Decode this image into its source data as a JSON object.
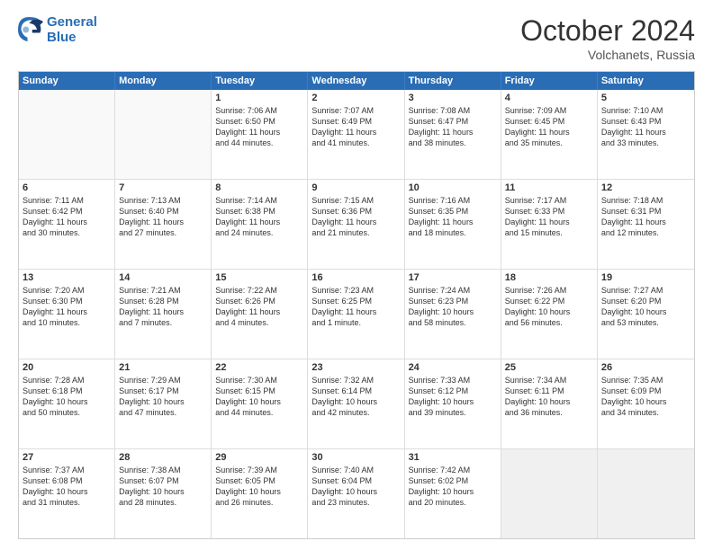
{
  "logo": {
    "line1": "General",
    "line2": "Blue"
  },
  "title": "October 2024",
  "location": "Volchanets, Russia",
  "days_of_week": [
    "Sunday",
    "Monday",
    "Tuesday",
    "Wednesday",
    "Thursday",
    "Friday",
    "Saturday"
  ],
  "weeks": [
    [
      {
        "day": "",
        "empty": true,
        "lines": []
      },
      {
        "day": "",
        "empty": true,
        "lines": []
      },
      {
        "day": "1",
        "lines": [
          "Sunrise: 7:06 AM",
          "Sunset: 6:50 PM",
          "Daylight: 11 hours",
          "and 44 minutes."
        ]
      },
      {
        "day": "2",
        "lines": [
          "Sunrise: 7:07 AM",
          "Sunset: 6:49 PM",
          "Daylight: 11 hours",
          "and 41 minutes."
        ]
      },
      {
        "day": "3",
        "lines": [
          "Sunrise: 7:08 AM",
          "Sunset: 6:47 PM",
          "Daylight: 11 hours",
          "and 38 minutes."
        ]
      },
      {
        "day": "4",
        "lines": [
          "Sunrise: 7:09 AM",
          "Sunset: 6:45 PM",
          "Daylight: 11 hours",
          "and 35 minutes."
        ]
      },
      {
        "day": "5",
        "lines": [
          "Sunrise: 7:10 AM",
          "Sunset: 6:43 PM",
          "Daylight: 11 hours",
          "and 33 minutes."
        ]
      }
    ],
    [
      {
        "day": "6",
        "lines": [
          "Sunrise: 7:11 AM",
          "Sunset: 6:42 PM",
          "Daylight: 11 hours",
          "and 30 minutes."
        ]
      },
      {
        "day": "7",
        "lines": [
          "Sunrise: 7:13 AM",
          "Sunset: 6:40 PM",
          "Daylight: 11 hours",
          "and 27 minutes."
        ]
      },
      {
        "day": "8",
        "lines": [
          "Sunrise: 7:14 AM",
          "Sunset: 6:38 PM",
          "Daylight: 11 hours",
          "and 24 minutes."
        ]
      },
      {
        "day": "9",
        "lines": [
          "Sunrise: 7:15 AM",
          "Sunset: 6:36 PM",
          "Daylight: 11 hours",
          "and 21 minutes."
        ]
      },
      {
        "day": "10",
        "lines": [
          "Sunrise: 7:16 AM",
          "Sunset: 6:35 PM",
          "Daylight: 11 hours",
          "and 18 minutes."
        ]
      },
      {
        "day": "11",
        "lines": [
          "Sunrise: 7:17 AM",
          "Sunset: 6:33 PM",
          "Daylight: 11 hours",
          "and 15 minutes."
        ]
      },
      {
        "day": "12",
        "lines": [
          "Sunrise: 7:18 AM",
          "Sunset: 6:31 PM",
          "Daylight: 11 hours",
          "and 12 minutes."
        ]
      }
    ],
    [
      {
        "day": "13",
        "lines": [
          "Sunrise: 7:20 AM",
          "Sunset: 6:30 PM",
          "Daylight: 11 hours",
          "and 10 minutes."
        ]
      },
      {
        "day": "14",
        "lines": [
          "Sunrise: 7:21 AM",
          "Sunset: 6:28 PM",
          "Daylight: 11 hours",
          "and 7 minutes."
        ]
      },
      {
        "day": "15",
        "lines": [
          "Sunrise: 7:22 AM",
          "Sunset: 6:26 PM",
          "Daylight: 11 hours",
          "and 4 minutes."
        ]
      },
      {
        "day": "16",
        "lines": [
          "Sunrise: 7:23 AM",
          "Sunset: 6:25 PM",
          "Daylight: 11 hours",
          "and 1 minute."
        ]
      },
      {
        "day": "17",
        "lines": [
          "Sunrise: 7:24 AM",
          "Sunset: 6:23 PM",
          "Daylight: 10 hours",
          "and 58 minutes."
        ]
      },
      {
        "day": "18",
        "lines": [
          "Sunrise: 7:26 AM",
          "Sunset: 6:22 PM",
          "Daylight: 10 hours",
          "and 56 minutes."
        ]
      },
      {
        "day": "19",
        "lines": [
          "Sunrise: 7:27 AM",
          "Sunset: 6:20 PM",
          "Daylight: 10 hours",
          "and 53 minutes."
        ]
      }
    ],
    [
      {
        "day": "20",
        "lines": [
          "Sunrise: 7:28 AM",
          "Sunset: 6:18 PM",
          "Daylight: 10 hours",
          "and 50 minutes."
        ]
      },
      {
        "day": "21",
        "lines": [
          "Sunrise: 7:29 AM",
          "Sunset: 6:17 PM",
          "Daylight: 10 hours",
          "and 47 minutes."
        ]
      },
      {
        "day": "22",
        "lines": [
          "Sunrise: 7:30 AM",
          "Sunset: 6:15 PM",
          "Daylight: 10 hours",
          "and 44 minutes."
        ]
      },
      {
        "day": "23",
        "lines": [
          "Sunrise: 7:32 AM",
          "Sunset: 6:14 PM",
          "Daylight: 10 hours",
          "and 42 minutes."
        ]
      },
      {
        "day": "24",
        "lines": [
          "Sunrise: 7:33 AM",
          "Sunset: 6:12 PM",
          "Daylight: 10 hours",
          "and 39 minutes."
        ]
      },
      {
        "day": "25",
        "lines": [
          "Sunrise: 7:34 AM",
          "Sunset: 6:11 PM",
          "Daylight: 10 hours",
          "and 36 minutes."
        ]
      },
      {
        "day": "26",
        "lines": [
          "Sunrise: 7:35 AM",
          "Sunset: 6:09 PM",
          "Daylight: 10 hours",
          "and 34 minutes."
        ]
      }
    ],
    [
      {
        "day": "27",
        "lines": [
          "Sunrise: 7:37 AM",
          "Sunset: 6:08 PM",
          "Daylight: 10 hours",
          "and 31 minutes."
        ]
      },
      {
        "day": "28",
        "lines": [
          "Sunrise: 7:38 AM",
          "Sunset: 6:07 PM",
          "Daylight: 10 hours",
          "and 28 minutes."
        ]
      },
      {
        "day": "29",
        "lines": [
          "Sunrise: 7:39 AM",
          "Sunset: 6:05 PM",
          "Daylight: 10 hours",
          "and 26 minutes."
        ]
      },
      {
        "day": "30",
        "lines": [
          "Sunrise: 7:40 AM",
          "Sunset: 6:04 PM",
          "Daylight: 10 hours",
          "and 23 minutes."
        ]
      },
      {
        "day": "31",
        "lines": [
          "Sunrise: 7:42 AM",
          "Sunset: 6:02 PM",
          "Daylight: 10 hours",
          "and 20 minutes."
        ]
      },
      {
        "day": "",
        "empty": true,
        "shaded": true,
        "lines": []
      },
      {
        "day": "",
        "empty": true,
        "shaded": true,
        "lines": []
      }
    ]
  ]
}
